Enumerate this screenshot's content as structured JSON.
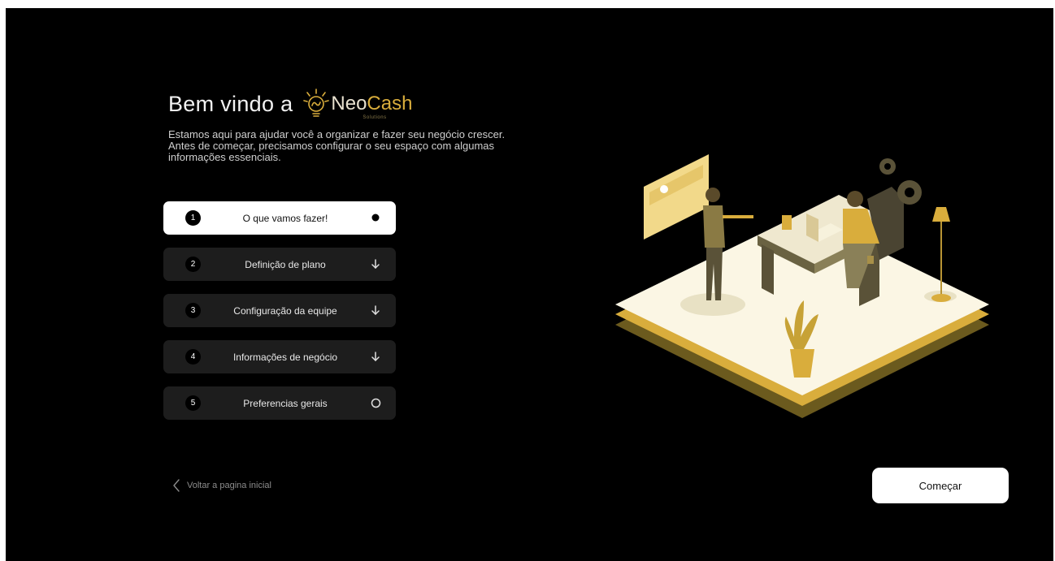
{
  "header": {
    "welcome_text": "Bem vindo a",
    "logo_neo": "Neo",
    "logo_cash": "Cash",
    "logo_sub": "Solutions"
  },
  "intro": {
    "line1": "Estamos aqui para ajudar você a organizar e fazer seu negócio crescer.",
    "line2": "Antes de começar, precisamos configurar o seu espaço com algumas",
    "line3": "informações essenciais."
  },
  "steps": [
    {
      "num": "1",
      "label": "O que vamos fazer!",
      "state": "active",
      "icon": "filled-dot-icon"
    },
    {
      "num": "2",
      "label": "Definição de plano",
      "state": "pending",
      "icon": "arrow-down-icon"
    },
    {
      "num": "3",
      "label": "Configuração da equipe",
      "state": "pending",
      "icon": "arrow-down-icon"
    },
    {
      "num": "4",
      "label": "Informações de negócio",
      "state": "pending",
      "icon": "arrow-down-icon"
    },
    {
      "num": "5",
      "label": "Preferencias gerais",
      "state": "pending",
      "icon": "empty-circle-icon"
    }
  ],
  "footer": {
    "back_label": "Voltar a pagina inicial",
    "start_label": "Começar"
  },
  "colors": {
    "background": "#000000",
    "accent_gold": "#d9ad3c",
    "step_inactive": "#1d1d1d",
    "step_active": "#ffffff"
  }
}
